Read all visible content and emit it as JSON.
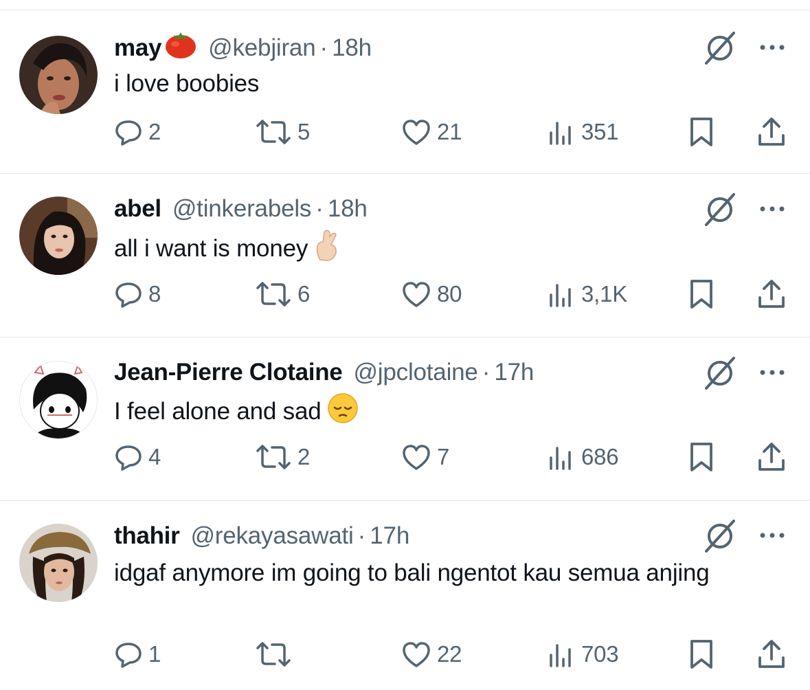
{
  "icons": {
    "reply": "reply-icon",
    "retweet": "retweet-icon",
    "like": "heart-icon",
    "views": "views-bar-chart-icon",
    "bookmark": "bookmark-icon",
    "share": "share-icon",
    "grok": "grok-slash-icon",
    "more": "more-dots-icon"
  },
  "colors": {
    "text": "#0f1419",
    "secondary": "#536471",
    "divider": "#e3e6ea"
  },
  "tweets": [
    {
      "name": "may",
      "name_emoji": "tomato",
      "handle": "@kebjiran",
      "separator": "·",
      "time": "18h",
      "text": "i love boobies",
      "text_emoji": "",
      "replies": "2",
      "retweets": "5",
      "likes": "21",
      "views": "351"
    },
    {
      "name": "abel",
      "name_emoji": "",
      "handle": "@tinkerabels",
      "separator": "·",
      "time": "18h",
      "text": "all i want is money",
      "text_emoji": "crossed-fingers",
      "replies": "8",
      "retweets": "6",
      "likes": "80",
      "views": "3,1K"
    },
    {
      "name": "Jean-Pierre Clotaine",
      "name_emoji": "",
      "handle": "@jpclotaine",
      "separator": "·",
      "time": "17h",
      "text": "I feel alone and sad",
      "text_emoji": "pensive-face",
      "replies": "4",
      "retweets": "2",
      "likes": "7",
      "views": "686"
    },
    {
      "name": "thahir",
      "name_emoji": "",
      "handle": "@rekayasawati",
      "separator": "·",
      "time": "17h",
      "text": "idgaf anymore im going to bali ngentot kau semua anjing",
      "text_emoji": "",
      "replies": "1",
      "retweets": "",
      "likes": "22",
      "views": "703"
    }
  ]
}
